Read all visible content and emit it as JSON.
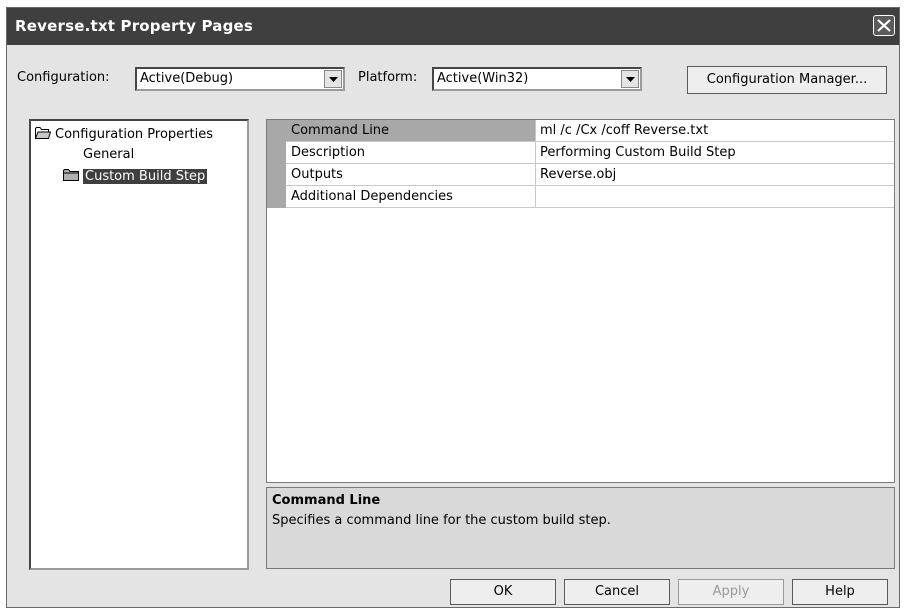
{
  "window": {
    "title": "Reverse.txt Property Pages"
  },
  "toolbar": {
    "configuration_label": "Configuration:",
    "configuration_value": "Active(Debug)",
    "platform_label": "Platform:",
    "platform_value": "Active(Win32)",
    "config_manager_label": "Configuration Manager..."
  },
  "tree": {
    "root_label": "Configuration Properties",
    "items": [
      {
        "label": "General"
      },
      {
        "label": "Custom Build Step",
        "selected": true
      }
    ]
  },
  "properties": [
    {
      "name": "Command Line",
      "value": "ml /c /Cx /coff Reverse.txt",
      "selected": true
    },
    {
      "name": "Description",
      "value": "Performing Custom Build Step"
    },
    {
      "name": "Outputs",
      "value": "Reverse.obj"
    },
    {
      "name": "Additional Dependencies",
      "value": ""
    }
  ],
  "description": {
    "title": "Command Line",
    "text": "Specifies a command line for the custom build step."
  },
  "buttons": {
    "ok": "OK",
    "cancel": "Cancel",
    "apply": "Apply",
    "help": "Help"
  },
  "icons": {
    "close": "close-icon",
    "dropdown": "chevron-down-icon",
    "folder_open": "folder-open-icon",
    "folder_closed": "folder-icon"
  }
}
